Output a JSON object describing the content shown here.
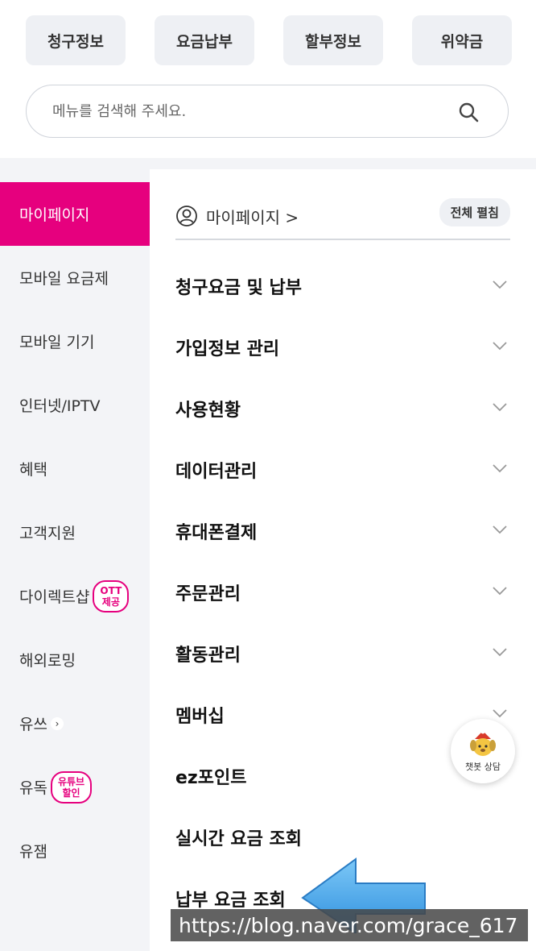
{
  "quick_menu": [
    "청구정보",
    "요금납부",
    "할부정보",
    "위약금"
  ],
  "search": {
    "placeholder": "메뉴를 검색해 주세요."
  },
  "sidebar": {
    "items": [
      {
        "label": "마이페이지",
        "active": true
      },
      {
        "label": "모바일 요금제"
      },
      {
        "label": "모바일 기기"
      },
      {
        "label": "인터넷/IPTV"
      },
      {
        "label": "혜택"
      },
      {
        "label": "고객지원"
      },
      {
        "label": "다이렉트샵",
        "badge": [
          "OTT",
          "제공"
        ]
      },
      {
        "label": "해외로밍"
      },
      {
        "label": "유쓰",
        "chevron": "›"
      },
      {
        "label": "유독",
        "badge": [
          "유튜브",
          "할인"
        ]
      },
      {
        "label": "유잼"
      }
    ]
  },
  "main": {
    "header_label": "마이페이지 >",
    "expand_all": "전체 펼침",
    "menu": [
      "청구요금 및 납부",
      "가입정보 관리",
      "사용현황",
      "데이터관리",
      "휴대폰결제",
      "주문관리",
      "활동관리",
      "멤버십",
      "ez포인트",
      "실시간 요금 조회",
      "납부 요금 조회"
    ]
  },
  "chatbot": {
    "label": "챗봇 상담"
  },
  "watermark": "https://blog.naver.com/grace_617",
  "colors": {
    "accent": "#e6007e",
    "sidebar_bg": "#f3f4f7",
    "arrow": "#3aa0e6"
  }
}
